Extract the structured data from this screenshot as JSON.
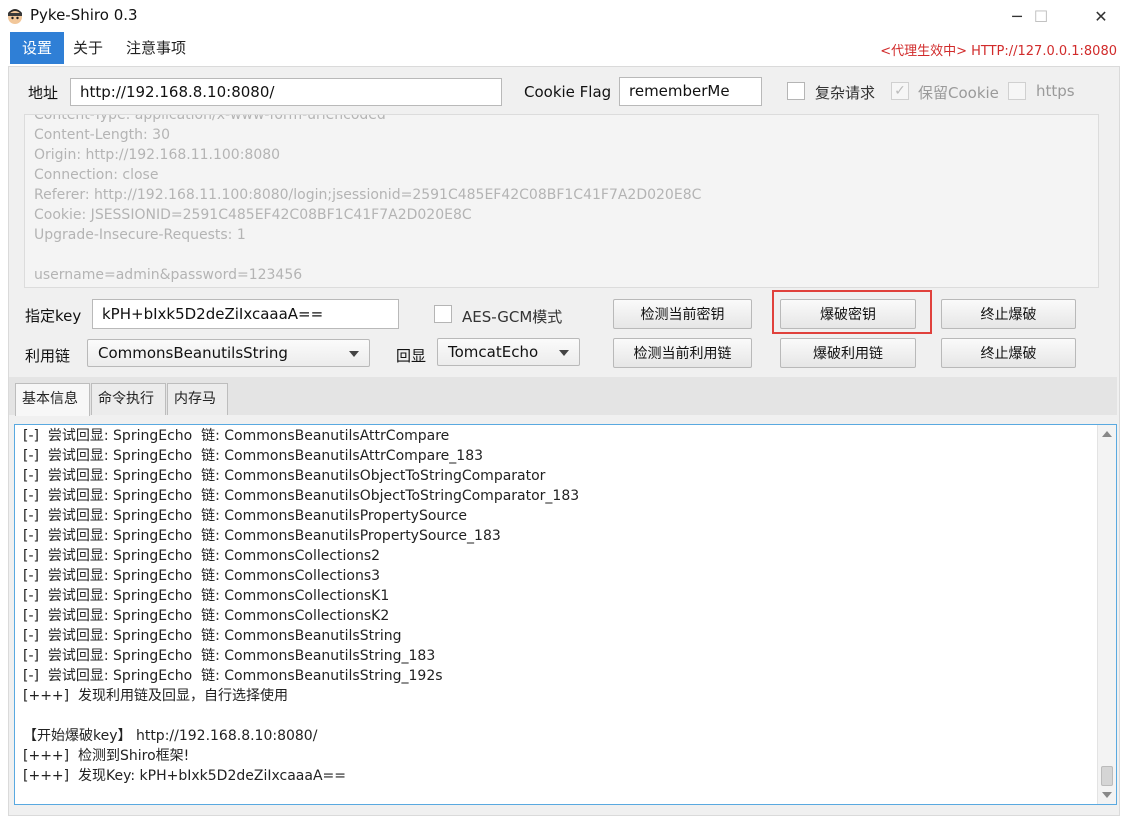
{
  "window": {
    "title": "Pyke-Shiro 0.3",
    "minimize": "─",
    "maximize": "☐",
    "close": "✕"
  },
  "menu": {
    "items": [
      "设置",
      "关于",
      "注意事项"
    ],
    "proxy_status": "<代理生效中> HTTP://127.0.0.1:8080"
  },
  "form": {
    "address_label": "地址",
    "address_value": "http://192.168.8.10:8080/",
    "cookie_flag_label": "Cookie Flag",
    "cookie_flag_value": "rememberMe",
    "complex_request_label": "复杂请求",
    "keep_cookie_label": "保留Cookie",
    "https_label": "https",
    "checkmark": "✓"
  },
  "request_lines": [
    "Content-Type: application/x-www-form-urlencoded",
    "Content-Length: 30",
    "Origin: http://192.168.11.100:8080",
    "Connection: close",
    "Referer: http://192.168.11.100:8080/login;jsessionid=2591C485EF42C08BF1C41F7A2D020E8C",
    "Cookie: JSESSIONID=2591C485EF42C08BF1C41F7A2D020E8C",
    "Upgrade-Insecure-Requests: 1",
    "",
    "username=admin&password=123456"
  ],
  "key": {
    "label": "指定key",
    "value": "kPH+bIxk5D2deZiIxcaaaA==",
    "aes_gcm_label": "AES-GCM模式",
    "check_key_button": "检测当前密钥",
    "crack_key_button": "爆破密钥",
    "stop_button": "终止爆破"
  },
  "chain": {
    "label": "利用链",
    "selected": "CommonsBeanutilsString",
    "echo_label": "回显",
    "echo_selected": "TomcatEcho",
    "check_chain_button": "检测当前利用链",
    "crack_chain_button": "爆破利用链",
    "stop_button": "终止爆破"
  },
  "tabs": [
    "基本信息",
    "命令执行",
    "内存马"
  ],
  "log_lines": [
    "[-]  尝试回显: SpringEcho  链: CommonsBeanutilsAttrCompare",
    "[-]  尝试回显: SpringEcho  链: CommonsBeanutilsAttrCompare_183",
    "[-]  尝试回显: SpringEcho  链: CommonsBeanutilsObjectToStringComparator",
    "[-]  尝试回显: SpringEcho  链: CommonsBeanutilsObjectToStringComparator_183",
    "[-]  尝试回显: SpringEcho  链: CommonsBeanutilsPropertySource",
    "[-]  尝试回显: SpringEcho  链: CommonsBeanutilsPropertySource_183",
    "[-]  尝试回显: SpringEcho  链: CommonsCollections2",
    "[-]  尝试回显: SpringEcho  链: CommonsCollections3",
    "[-]  尝试回显: SpringEcho  链: CommonsCollectionsK1",
    "[-]  尝试回显: SpringEcho  链: CommonsCollectionsK2",
    "[-]  尝试回显: SpringEcho  链: CommonsBeanutilsString",
    "[-]  尝试回显: SpringEcho  链: CommonsBeanutilsString_183",
    "[-]  尝试回显: SpringEcho  链: CommonsBeanutilsString_192s",
    "[+++]  发现利用链及回显，自行选择使用",
    "",
    "【开始爆破key】 http://192.168.8.10:8080/",
    "[+++]  检测到Shiro框架!",
    "[+++]  发现Key: kPH+bIxk5D2deZiIxcaaaA=="
  ]
}
